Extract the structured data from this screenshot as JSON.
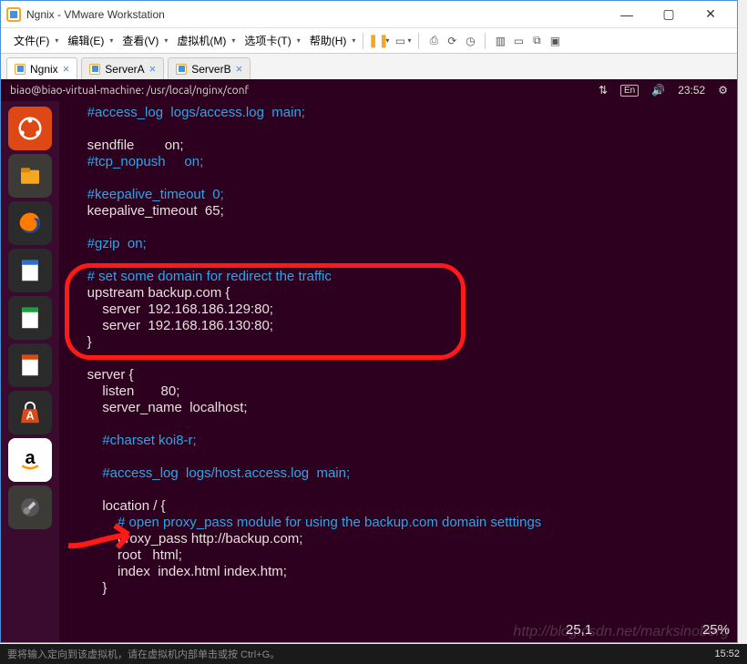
{
  "window": {
    "title": "Ngnix - VMware Workstation",
    "minimize": "—",
    "maximize": "▢",
    "close": "✕"
  },
  "menubar": {
    "items": [
      "文件(F)",
      "编辑(E)",
      "查看(V)",
      "虚拟机(M)",
      "选项卡(T)",
      "帮助(H)"
    ]
  },
  "toolbar_icons": {
    "pause": "❚❚",
    "box": "▭",
    "printer": "⎙",
    "refresh": "⟳",
    "clock": "◷",
    "cd": "◉",
    "screens": "▥",
    "monitor": "▭",
    "network": "⧉",
    "full": "▣"
  },
  "tabs": [
    {
      "label": "Ngnix",
      "active": true
    },
    {
      "label": "ServerA",
      "active": false
    },
    {
      "label": "ServerB",
      "active": false
    }
  ],
  "ubuntu": {
    "path": "biao@biao-virtual-machine: /usr/local/nginx/conf",
    "indicators": {
      "lang": "En",
      "vol": "🔊",
      "time": "23:52",
      "gear": "⚙"
    }
  },
  "launcher": {
    "items": [
      {
        "name": "ubuntu-dash",
        "glyph": "◌"
      },
      {
        "name": "files",
        "glyph": "🗀"
      },
      {
        "name": "firefox",
        "glyph": "🦊"
      },
      {
        "name": "libre-writer",
        "glyph": "📄"
      },
      {
        "name": "libre-calc",
        "glyph": "📊"
      },
      {
        "name": "libre-impress",
        "glyph": "📕"
      },
      {
        "name": "software-center",
        "glyph": "A"
      },
      {
        "name": "amazon",
        "glyph": "a"
      },
      {
        "name": "settings",
        "glyph": "🔧"
      },
      {
        "name": "terminal",
        "glyph": ">_"
      }
    ]
  },
  "editor": {
    "lines": [
      {
        "cls": "cmt",
        "text": "    #access_log  logs/access.log  main;"
      },
      {
        "cls": "",
        "text": ""
      },
      {
        "cls": "kw",
        "text": "    sendfile        on;"
      },
      {
        "cls": "cmt",
        "text": "    #tcp_nopush     on;"
      },
      {
        "cls": "",
        "text": ""
      },
      {
        "cls": "cmt",
        "text": "    #keepalive_timeout  0;"
      },
      {
        "cls": "kw",
        "text": "    keepalive_timeout  65;"
      },
      {
        "cls": "",
        "text": ""
      },
      {
        "cls": "cmt",
        "text": "    #gzip  on;"
      },
      {
        "cls": "",
        "text": ""
      },
      {
        "cls": "cmt",
        "text": "    # set some domain for redirect the traffic"
      },
      {
        "cls": "kw",
        "text": "    upstream backup.com {"
      },
      {
        "cls": "kw",
        "text": "        server  192.168.186.129:80;"
      },
      {
        "cls": "kw",
        "text": "        server  192.168.186.130:80;"
      },
      {
        "cls": "kw",
        "text": "    }"
      },
      {
        "cls": "",
        "text": ""
      },
      {
        "cls": "kw",
        "text": "    server {"
      },
      {
        "cls": "kw",
        "text": "        listen       80;"
      },
      {
        "cls": "kw",
        "text": "        server_name  localhost;"
      },
      {
        "cls": "",
        "text": ""
      },
      {
        "cls": "cmt",
        "text": "        #charset koi8-r;"
      },
      {
        "cls": "",
        "text": ""
      },
      {
        "cls": "cmt",
        "text": "        #access_log  logs/host.access.log  main;"
      },
      {
        "cls": "",
        "text": ""
      },
      {
        "cls": "kw",
        "text": "        location / {"
      },
      {
        "cls": "cmt",
        "text": "            # open proxy_pass module for using the backup.com domain setttings"
      },
      {
        "cls": "kw",
        "text": "            proxy_pass http://backup.com;"
      },
      {
        "cls": "kw",
        "text": "            root   html;"
      },
      {
        "cls": "kw",
        "text": "            index  index.html index.htm;"
      },
      {
        "cls": "kw",
        "text": "        }"
      }
    ],
    "status": {
      "pos": "25,1",
      "pct": "25%"
    }
  },
  "host": {
    "hint": "要将输入定向到该虚拟机，请在虚拟机内部单击或按 Ctrl+G。",
    "clock": "15:52"
  },
  "watermark": "http://blog.csdn.net/marksinoberg",
  "colors": {
    "comment": "#2da6e8",
    "text": "#e6e1dc",
    "bg": "#2c001e",
    "annotation": "#ff1a1a"
  }
}
